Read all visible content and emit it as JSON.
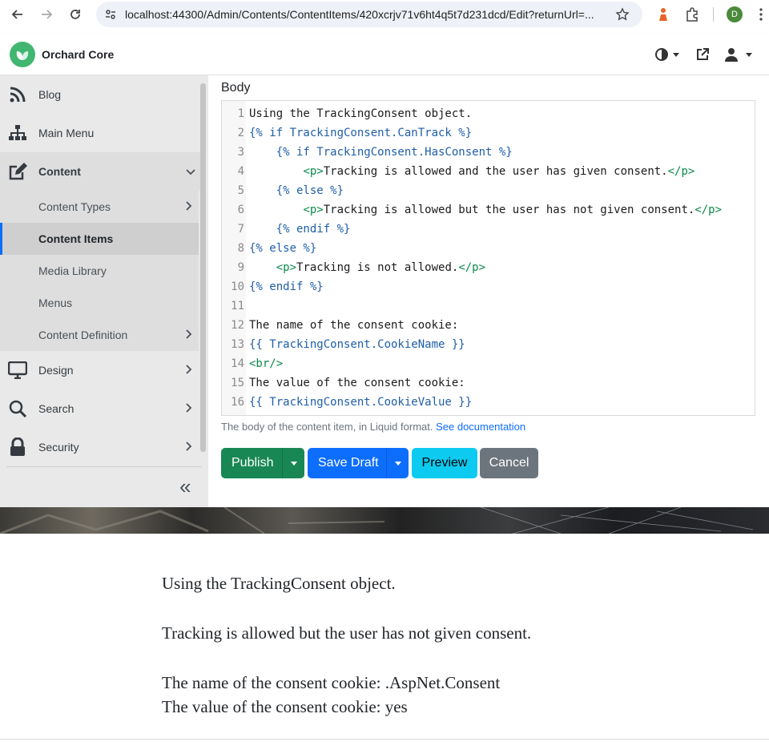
{
  "browser": {
    "url": "localhost:44300/Admin/Contents/ContentItems/420xcrjv71v6ht4q5t7d231dcd/Edit?returnUrl=...",
    "profile_initial": "D"
  },
  "header": {
    "brand": "Orchard Core"
  },
  "sidebar": {
    "items": [
      {
        "label": "Blog",
        "icon": "rss-icon"
      },
      {
        "label": "Main Menu",
        "icon": "sitemap-icon"
      },
      {
        "label": "Content",
        "icon": "edit-icon"
      },
      {
        "label": "Design",
        "icon": "desktop-icon"
      },
      {
        "label": "Search",
        "icon": "search-icon"
      },
      {
        "label": "Security",
        "icon": "lock-icon"
      }
    ],
    "content_submenu": [
      {
        "label": "Content Types"
      },
      {
        "label": "Content Items"
      },
      {
        "label": "Media Library"
      },
      {
        "label": "Menus"
      },
      {
        "label": "Content Definition"
      }
    ],
    "collapse_glyph": "«"
  },
  "editor": {
    "field_label": "Body",
    "lines": [
      {
        "n": "1",
        "parts": [
          [
            "t",
            "Using the TrackingConsent object."
          ]
        ]
      },
      {
        "n": "2",
        "parts": [
          [
            "l",
            "{% if TrackingConsent.CanTrack %}"
          ]
        ]
      },
      {
        "n": "3",
        "parts": [
          [
            "t",
            "    "
          ],
          [
            "l",
            "{% if TrackingConsent.HasConsent %}"
          ]
        ]
      },
      {
        "n": "4",
        "parts": [
          [
            "t",
            "        "
          ],
          [
            "g",
            "<p>"
          ],
          [
            "t",
            "Tracking is allowed and the user has given consent."
          ],
          [
            "g",
            "</p>"
          ]
        ]
      },
      {
        "n": "5",
        "parts": [
          [
            "t",
            "    "
          ],
          [
            "l",
            "{% else %}"
          ]
        ]
      },
      {
        "n": "6",
        "parts": [
          [
            "t",
            "        "
          ],
          [
            "g",
            "<p>"
          ],
          [
            "t",
            "Tracking is allowed but the user has not given consent."
          ],
          [
            "g",
            "</p>"
          ]
        ]
      },
      {
        "n": "7",
        "parts": [
          [
            "t",
            "    "
          ],
          [
            "l",
            "{% endif %}"
          ]
        ]
      },
      {
        "n": "8",
        "parts": [
          [
            "l",
            "{% else %}"
          ]
        ]
      },
      {
        "n": "9",
        "parts": [
          [
            "t",
            "    "
          ],
          [
            "g",
            "<p>"
          ],
          [
            "t",
            "Tracking is not allowed."
          ],
          [
            "g",
            "</p>"
          ]
        ]
      },
      {
        "n": "10",
        "parts": [
          [
            "l",
            "{% endif %}"
          ]
        ]
      },
      {
        "n": "11",
        "parts": []
      },
      {
        "n": "12",
        "parts": [
          [
            "t",
            "The name of the consent cookie:"
          ]
        ]
      },
      {
        "n": "13",
        "parts": [
          [
            "l",
            "{{ TrackingConsent.CookieName }}"
          ]
        ]
      },
      {
        "n": "14",
        "parts": [
          [
            "g",
            "<br/>"
          ]
        ]
      },
      {
        "n": "15",
        "parts": [
          [
            "t",
            "The value of the consent cookie:"
          ]
        ]
      },
      {
        "n": "16",
        "parts": [
          [
            "l",
            "{{ TrackingConsent.CookieValue }}"
          ]
        ]
      }
    ],
    "help_text": "The body of the content item, in Liquid format.",
    "help_link": "See documentation"
  },
  "actions": {
    "publish": "Publish",
    "save_draft": "Save Draft",
    "preview": "Preview",
    "cancel": "Cancel"
  },
  "preview": {
    "line1": "Using the TrackingConsent object.",
    "line2": "Tracking is allowed but the user has not given consent.",
    "line3": "The name of the consent cookie: .AspNet.Consent",
    "line4": "The value of the consent cookie: yes"
  },
  "colors": {
    "publish": "#198754",
    "save_draft": "#0d6efd",
    "preview": "#0dcaf0",
    "cancel": "#6c757d",
    "brand": "#41b670"
  }
}
